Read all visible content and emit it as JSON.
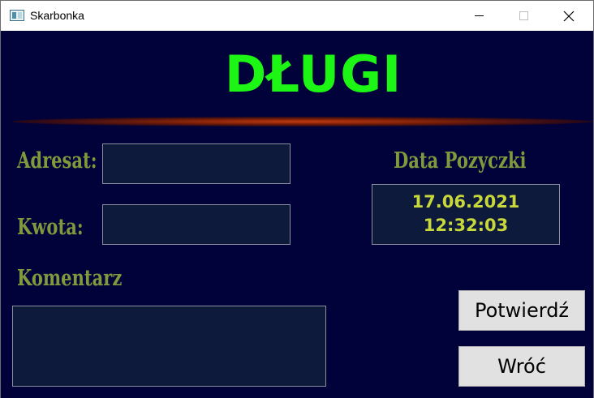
{
  "window": {
    "title": "Skarbonka"
  },
  "page": {
    "heading": "DŁUGI"
  },
  "form": {
    "adresat_label": "Adresat:",
    "adresat_value": "",
    "kwota_label": "Kwota:",
    "kwota_value": "",
    "komentarz_label": "Komentarz",
    "komentarz_value": ""
  },
  "loan_date": {
    "label": "Data Pozyczki",
    "date": "17.06.2021",
    "time": "12:32:03"
  },
  "buttons": {
    "confirm_label": "Potwierdź",
    "back_label": "Wróć"
  },
  "colors": {
    "background": "#02023a",
    "heading": "#1df514",
    "label": "#7f9a3c",
    "date_text": "#c8d83a",
    "divider": "#c23a10"
  }
}
